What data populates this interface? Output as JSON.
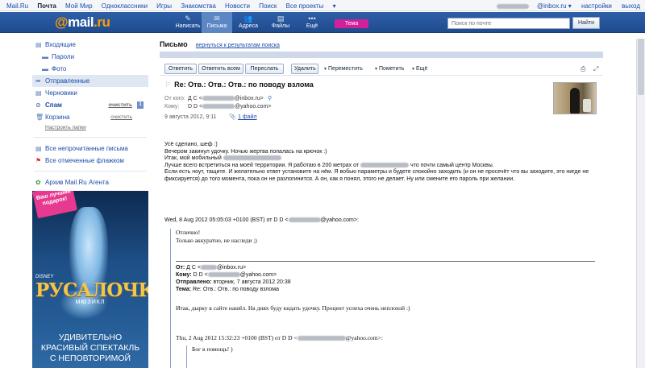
{
  "portal": {
    "links": [
      "Mail.Ru",
      "Почта",
      "Мой Мир",
      "Одноклассники",
      "Игры",
      "Знакомства",
      "Новости",
      "Поиск",
      "Все проекты"
    ],
    "active_index": 1,
    "user_suffix": "@inbox.ru",
    "settings": "настройки",
    "logout": "выход"
  },
  "header": {
    "logo_at": "@",
    "logo_main": "mail",
    "logo_ru": ".ru",
    "nav": [
      {
        "label": "Написать",
        "icon": "pencil-icon",
        "glyph": "✎"
      },
      {
        "label": "Письма",
        "icon": "envelope-icon",
        "glyph": "✉"
      },
      {
        "label": "Адреса",
        "icon": "contacts-icon",
        "glyph": "👥"
      },
      {
        "label": "Файлы",
        "icon": "folder-icon",
        "glyph": "▤"
      },
      {
        "label": "Ещё",
        "icon": "more-icon",
        "glyph": "•••"
      }
    ],
    "theme_label": "Тема",
    "search_placeholder": "Поиск по почте",
    "search_button": "Найти",
    "accent": "#1f4b8f"
  },
  "sidebar": {
    "folders": [
      {
        "label": "Входящие",
        "icon": "inbox-icon",
        "glyph": "▤",
        "type": "item"
      },
      {
        "label": "Пароли",
        "icon": "folder-icon",
        "glyph": "▬",
        "type": "sub"
      },
      {
        "label": "Фото",
        "icon": "folder-icon",
        "glyph": "▬",
        "type": "sub"
      },
      {
        "label": "Отправленные",
        "icon": "sent-icon",
        "glyph": "➦",
        "type": "item",
        "selected": true
      },
      {
        "label": "Черновики",
        "icon": "drafts-icon",
        "glyph": "▤",
        "type": "item"
      },
      {
        "label": "Спам",
        "icon": "spam-icon",
        "glyph": "⊘",
        "type": "item",
        "bold": true,
        "action": "очистить",
        "count": "1"
      },
      {
        "label": "Корзина",
        "icon": "trash-icon",
        "glyph": "🗑",
        "type": "item",
        "action": "очистить"
      }
    ],
    "setup_folders": "Настроить папки",
    "filters": [
      {
        "label": "Все непрочитанные письма",
        "icon": "unread-icon",
        "glyph": "▤"
      },
      {
        "label": "Все отмеченные флажком",
        "icon": "flag-icon",
        "glyph": "⚑"
      }
    ],
    "archive": {
      "label": "Архив Mail.Ru Агента",
      "icon": "agent-icon",
      "glyph": "✿"
    }
  },
  "banner": {
    "badge": "Ваш лучший подарок!",
    "brand": "DISNEY",
    "title": "РУСАЛОЧКА",
    "subtitle": "МЮЗИКЛ",
    "lines": [
      "УДИВИТЕЛЬНО",
      "КРАСИВЫЙ СПЕКТАКЛЬ",
      "С НЕПОВТОРИМОЙ"
    ]
  },
  "message_view": {
    "heading": "Письмо",
    "back_link": "вернуться к результатам поиска",
    "toolbar": {
      "reply": "Ответить",
      "reply_all": "Ответить всем",
      "forward": "Переслать",
      "delete": "Удалить",
      "move": "Переместить",
      "mark": "Пометить",
      "more": "Ещё"
    },
    "subject": "Re: Отв.: Отв.: Отв.: по поводу взлома",
    "from_label": "От кого:",
    "from_name": "Д С",
    "from_domain": "@inbox.ru",
    "to_label": "Кому:",
    "to_name": "D D",
    "to_domain": "@yahoo.com",
    "date": "9 августа 2012, 9:11",
    "attachment": "1 файл"
  },
  "body": {
    "line1": "Усё сделано, шеф :)",
    "line2": "Вечером закинул удочку. Ночью жертва попалась на крючок :)",
    "line3": "Итак, мой мобильный",
    "line4a": "Лучше всего встретиться на моей территории. Я работаю в 200 метрах от",
    "line4b": "что почти самый центр Москвы.",
    "line5": "Если есть ноут, тащите. И желательно ответ установите на нём. Я вобью параметры и будете спокойно заходить (и он не просечёт что вы заходите, это нигде не фиксируется) до того момента, пока он не разлогинится. А он, как я понял, этого не делает. Ну или смените его пароль при желании.",
    "quote_header_a": "Wed, 8 Aug 2012 05:05:03 +0100 (BST) от D D <",
    "quote_header_b": "@yahoo.com>:",
    "quote_lines": [
      "Отлично!",
      "Только аккуратно, не наследи ;)"
    ],
    "fwd_from_label": "От:",
    "fwd_from_name": "Д С <",
    "fwd_from_domain": "@inbox.ru>",
    "fwd_to_label": "Кому:",
    "fwd_to_name": "D D <",
    "fwd_to_domain": "@yahoo.com>",
    "fwd_sent_label": "Отправлено:",
    "fwd_sent_value": "вторник, 7 августа 2012 20:38",
    "fwd_subject_label": "Тема:",
    "fwd_subject_value": "Re: Отв.: Отв.: по поводу взлома",
    "quote_text": "Итак, дырку в сайте нашёл. На днях буду кидать удочку. Процент успеха очень неплохой :)",
    "quote2_header_a": "Thu, 2 Aug 2012 15:32:23 +0100 (BST) от D D <",
    "quote2_header_b": "@yahoo.com>:",
    "quote2_line": "Бог в помощь! )"
  }
}
